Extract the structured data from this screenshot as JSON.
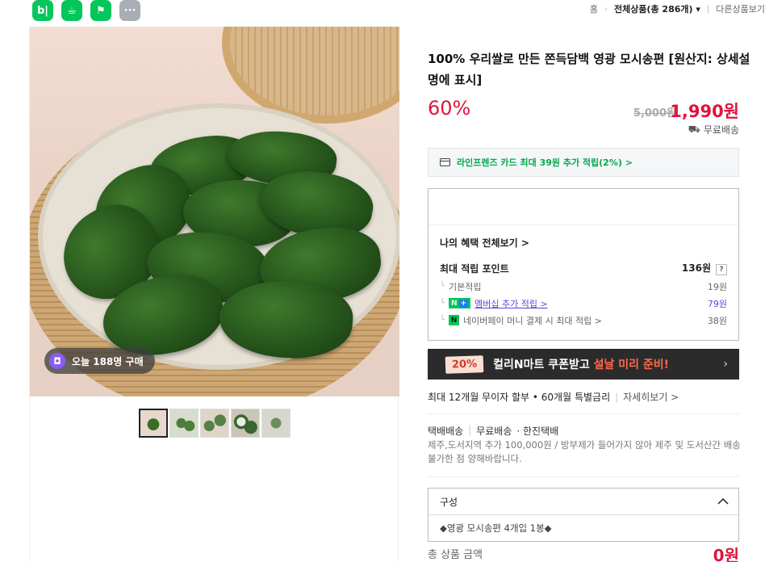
{
  "top_icons": [
    {
      "name": "blog",
      "label": "b|"
    },
    {
      "name": "cafe",
      "label": "☕"
    },
    {
      "name": "bookmark",
      "label": "⚑"
    },
    {
      "name": "more",
      "label": "···"
    }
  ],
  "breadcrumb": {
    "home": "홈",
    "all_products": "전체상품(총 286개)",
    "other_products": "다른상품보기"
  },
  "gallery": {
    "today_badge": "오늘 188명 구매",
    "thumbnails": 5,
    "active_thumbnail": 1
  },
  "product": {
    "title": "100% 우리쌀로 만든 쫀득담백 영광 모시송편 [원산지: 상세설명에 표시]",
    "discount": "60%",
    "original_price": "5,000원",
    "sale_price": "1,990원",
    "shipping": "무료배송"
  },
  "card_promo": "라인프렌즈 카드 최대 39원 추가 적립(2%) >",
  "benefits": {
    "view_all": "나의 혜택 전체보기 >",
    "max_points_label": "최대 적립 포인트",
    "max_points_value": "136원",
    "help_label": "?",
    "rows": [
      {
        "label": "기본적립",
        "value": "19원"
      },
      {
        "badge": "N+",
        "label": "멤버십 추가 적립 >",
        "value": "79원"
      },
      {
        "badge": "N",
        "label": "네이버페이 머니 결제 시 최대 적립 >",
        "value": "38원"
      }
    ]
  },
  "coupon_banner": {
    "badge": "20%",
    "text": "컬리N마트 쿠폰받고",
    "highlight": "설날 미리 준비!",
    "chevron": "›"
  },
  "installment": {
    "text": "최대 12개월 무이자 할부 • 60개월 특별금리",
    "more": "자세히보기 >"
  },
  "delivery": {
    "tags": [
      "택배배송",
      "무료배송",
      "· 한진택배"
    ],
    "note": "제주,도서지역 추가 100,000원 / 방부제가 들어가지 않아 제주 및 도서산간 배송 불가한 점 양해바랍니다."
  },
  "option": {
    "label": "구성",
    "item": "◆영광 모시송편 4개입 1봉◆"
  },
  "total": {
    "label": "총 상품 금액",
    "price": "0원"
  },
  "colors": {
    "naver_green": "#03c75a",
    "price_red": "#e0143c",
    "membership_purple": "#6540d8"
  }
}
